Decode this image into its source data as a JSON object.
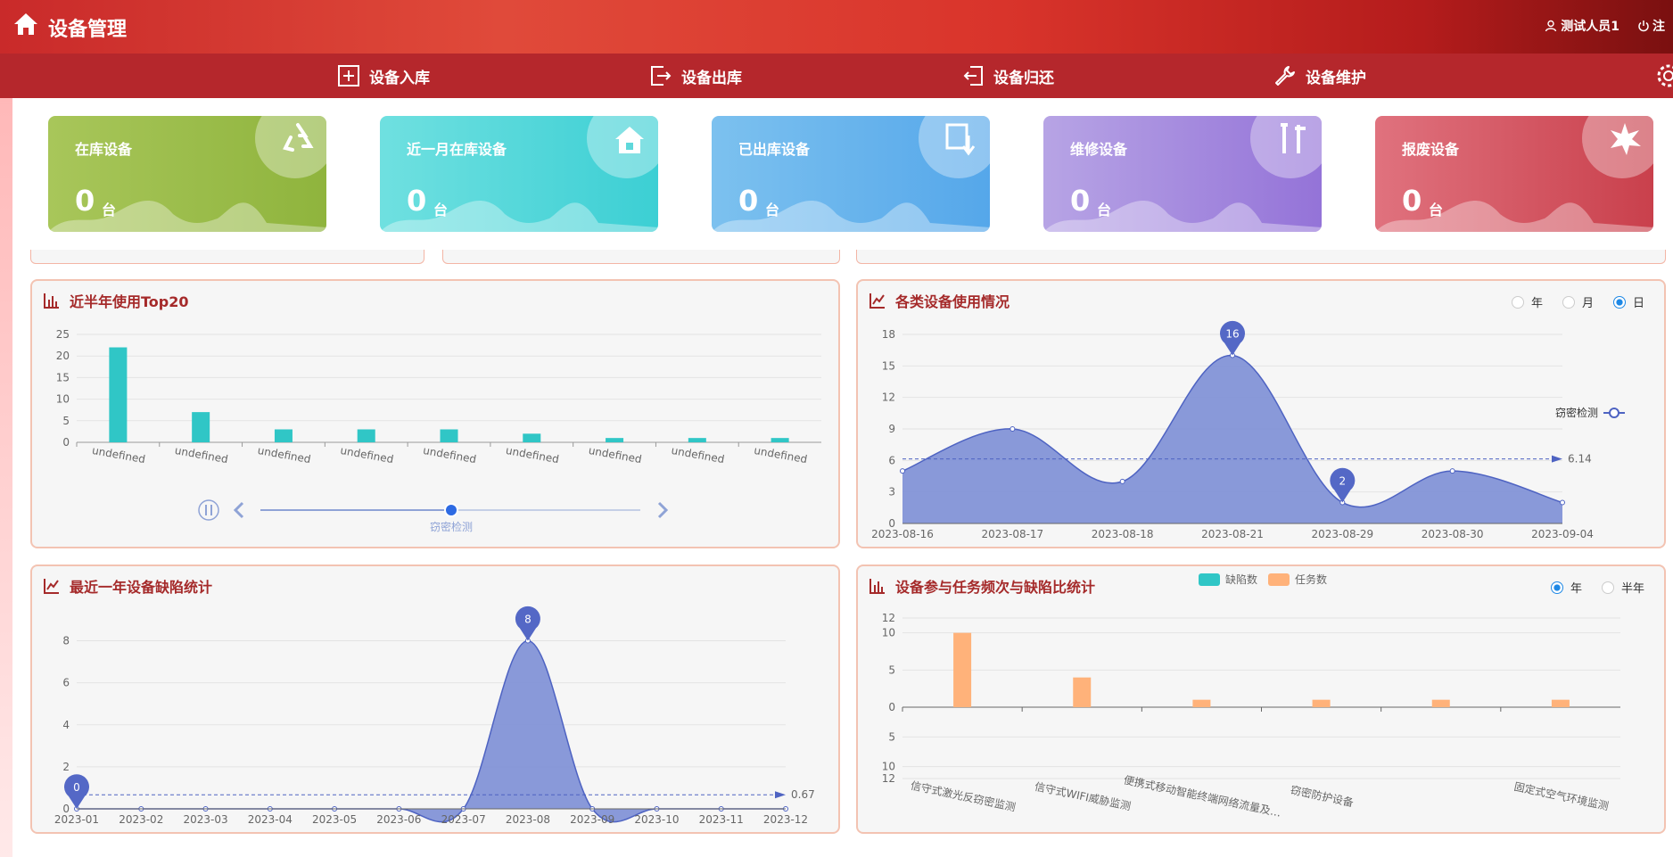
{
  "header": {
    "title": "设备管理",
    "user": "测试人员1",
    "logout": "注"
  },
  "nav": {
    "items": [
      {
        "label": "设备入库",
        "icon": "plus-square-icon"
      },
      {
        "label": "设备出库",
        "icon": "export-icon"
      },
      {
        "label": "设备归还",
        "icon": "import-icon"
      },
      {
        "label": "设备维护",
        "icon": "wrench-icon"
      }
    ]
  },
  "stats": [
    {
      "label": "在库设备",
      "value": "0",
      "unit": "台",
      "color1": "#a8c65a",
      "color2": "#8fb43d",
      "icon": "recycle-icon"
    },
    {
      "label": "近一月在库设备",
      "value": "0",
      "unit": "台",
      "color1": "#6fe0e0",
      "color2": "#3ccfd4",
      "icon": "house-icon"
    },
    {
      "label": "已出库设备",
      "value": "0",
      "unit": "台",
      "color1": "#7cc1ef",
      "color2": "#55a7ea",
      "icon": "box-out-icon"
    },
    {
      "label": "维修设备",
      "value": "0",
      "unit": "台",
      "color1": "#b7a4e5",
      "color2": "#9473d8",
      "icon": "tools-icon"
    },
    {
      "label": "报废设备",
      "value": "0",
      "unit": "台",
      "color1": "#e0727e",
      "color2": "#c9404c",
      "icon": "burst-icon"
    }
  ],
  "panels": {
    "top20": {
      "title": "近半年使用Top20",
      "slider_label": "窃密检测"
    },
    "usage": {
      "title": "各类设备使用情况",
      "radios": [
        "年",
        "月",
        "日"
      ],
      "selected": "日",
      "legend": "窃密检测",
      "avg_label": "6.14",
      "max_label": "16",
      "min_label": "2"
    },
    "defects": {
      "title": "最近一年设备缺陷统计",
      "avg_label": "0.67",
      "max_label": "8",
      "min_label": "0"
    },
    "freq": {
      "title": "设备参与任务频次与缺陷比统计",
      "legend": [
        "缺陷数",
        "任务数"
      ],
      "radios": [
        "年",
        "半年"
      ],
      "selected": "年"
    }
  },
  "chart_data": [
    {
      "type": "bar",
      "title": "近半年使用Top20",
      "categories": [
        "undefined",
        "undefined",
        "undefined",
        "undefined",
        "undefined",
        "undefined",
        "undefined",
        "undefined",
        "undefined"
      ],
      "values": [
        22,
        7,
        3,
        3,
        3,
        2,
        1,
        1,
        1
      ],
      "yticks": [
        0,
        5,
        10,
        15,
        20,
        25
      ],
      "ylim": [
        0,
        25
      ],
      "color": "#30c6c6"
    },
    {
      "type": "area",
      "title": "各类设备使用情况",
      "x": [
        "2023-08-16",
        "2023-08-17",
        "2023-08-18",
        "2023-08-21",
        "2023-08-29",
        "2023-08-30",
        "2023-09-04"
      ],
      "series": [
        {
          "name": "窃密检测",
          "values": [
            5,
            9,
            4,
            16,
            2,
            5,
            2
          ]
        }
      ],
      "yticks": [
        0,
        3,
        6,
        9,
        12,
        15,
        18
      ],
      "ylim": [
        0,
        18
      ],
      "average": 6.14,
      "color": "#5b73c9"
    },
    {
      "type": "area",
      "title": "最近一年设备缺陷统计",
      "x": [
        "2023-01",
        "2023-02",
        "2023-03",
        "2023-04",
        "2023-05",
        "2023-06",
        "2023-07",
        "2023-08",
        "2023-09",
        "2023-10",
        "2023-11",
        "2023-12"
      ],
      "values": [
        0,
        0,
        0,
        0,
        0,
        0,
        0,
        8,
        0,
        0,
        0,
        0
      ],
      "yticks": [
        0,
        2,
        4,
        6,
        8
      ],
      "ylim": [
        0,
        9
      ],
      "average": 0.67,
      "color": "#5b73c9"
    },
    {
      "type": "bar",
      "title": "设备参与任务频次与缺陷比统计",
      "categories": [
        "信守式激光反窃密监测",
        "信守式WIFI威胁监测",
        "便携式移动智能终端网络流量及…",
        "窃密防护设备",
        "",
        "固定式空气环境监测"
      ],
      "series": [
        {
          "name": "缺陷数",
          "values": [
            0,
            0,
            0,
            0,
            0,
            0
          ]
        },
        {
          "name": "任务数",
          "values": [
            10,
            4,
            1,
            1,
            1,
            1
          ]
        }
      ],
      "yticks_top": [
        0,
        5,
        10,
        12
      ],
      "yticks_bottom": [
        5,
        10,
        12
      ],
      "colors": [
        "#30c6c6",
        "#ffb27a"
      ]
    }
  ]
}
